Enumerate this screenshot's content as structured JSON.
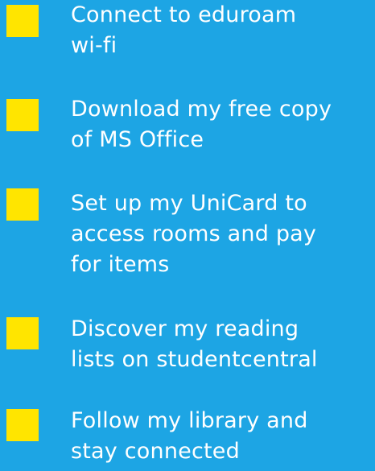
{
  "colors": {
    "background": "#1DA5E4",
    "checkbox": "#FFE500",
    "text": "#FFFFFF"
  },
  "checklist": {
    "items": [
      {
        "label": "Connect to eduroam\nwi-fi",
        "checked": false
      },
      {
        "label": "Download my free copy\nof MS Office",
        "checked": false
      },
      {
        "label": "Set up my UniCard to\naccess rooms and pay\nfor items",
        "checked": false
      },
      {
        "label": "Discover my reading\nlists on studentcentral",
        "checked": false
      },
      {
        "label": "Follow my library and\nstay connected",
        "checked": false
      }
    ]
  }
}
